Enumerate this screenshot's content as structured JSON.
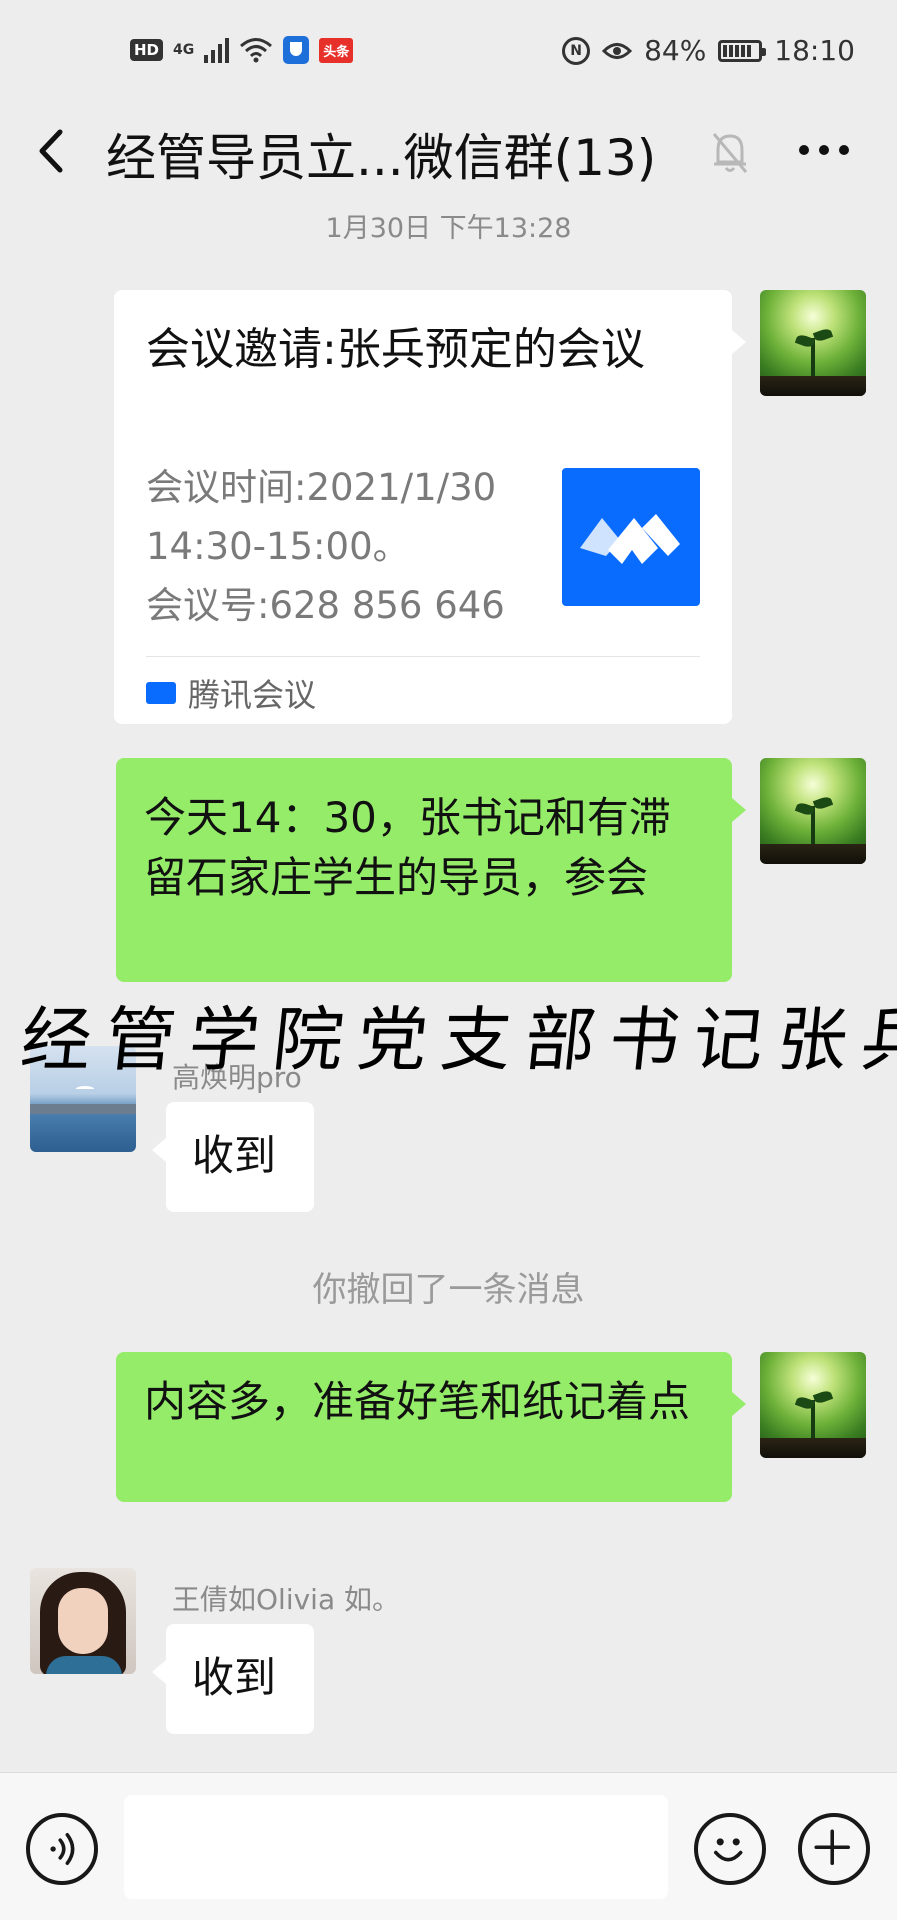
{
  "status_bar": {
    "hd_badge": "HD",
    "network": "4G",
    "toutiao_badge": "头条",
    "battery_percent": "84%",
    "time": "18:10",
    "icons": [
      "hd-icon",
      "signal-icon",
      "wifi-icon",
      "shield-app-icon",
      "toutiao-icon",
      "nfc-icon",
      "eye-comfort-icon",
      "battery-icon"
    ]
  },
  "header": {
    "title": "经管导员立...微信群(13)",
    "icons": [
      "back-chevron-icon",
      "mute-bell-icon",
      "more-dots-icon"
    ]
  },
  "timestamp": "1月30日 下午13:28",
  "messages": {
    "meeting_card": {
      "title": "会议邀请:张兵预定的会议",
      "desc_lines": [
        "会议时间:2021/1/30",
        "14:30-15:00。",
        "会议号:628 856 646"
      ],
      "source": "腾讯会议"
    },
    "msg1_text": "今天14：30，张书记和有滞留石家庄学生的导员，参会",
    "reply1": {
      "sender": "高焕明pro",
      "text": "收到"
    },
    "recall_notice": "你撤回了一条消息",
    "msg2_text": "内容多，准备好笔和纸记着点",
    "reply2": {
      "sender": "王倩如Olivia 如。",
      "text": "收到"
    }
  },
  "watermark_text": "经管学院党支部书记张兵",
  "input_bar": {
    "icons": [
      "voice-icon",
      "emoji-icon",
      "plus-icon"
    ]
  },
  "colors": {
    "background": "#ededed",
    "self_bubble": "#95ec69",
    "other_bubble": "#ffffff",
    "tencent_meeting_blue": "#0a6cff"
  }
}
